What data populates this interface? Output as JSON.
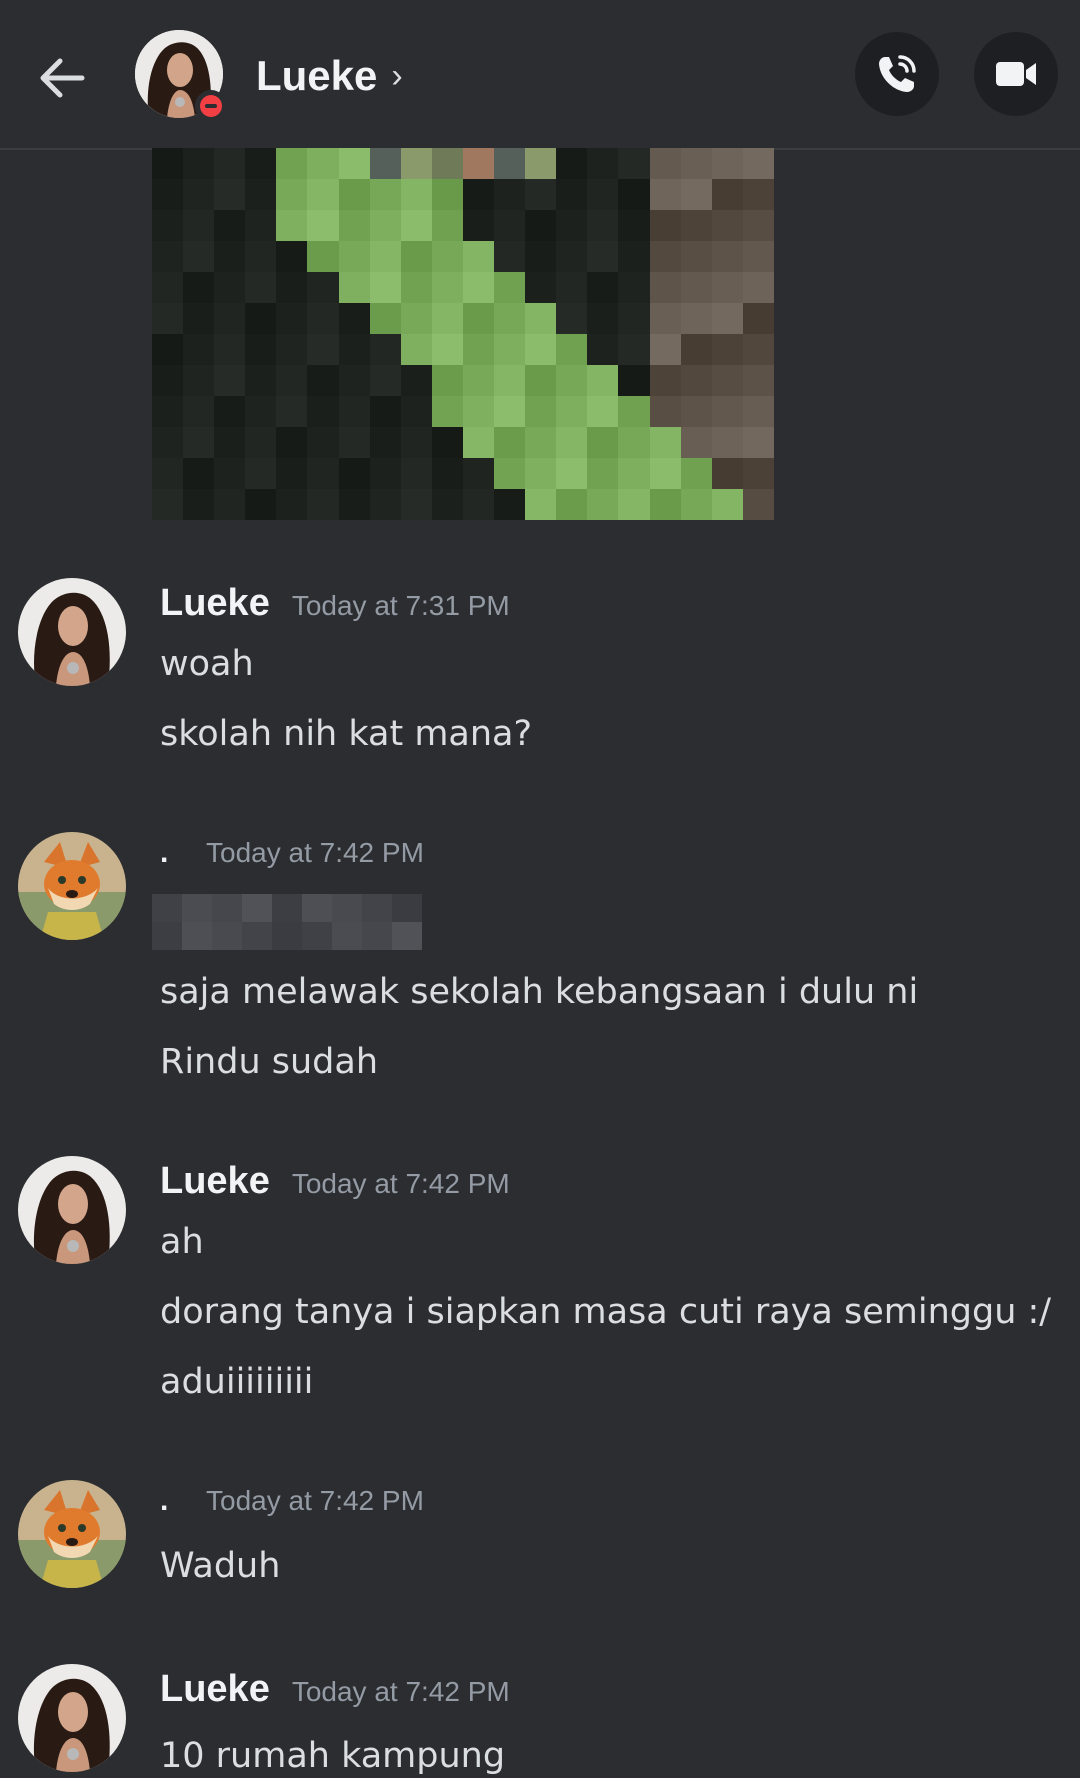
{
  "header": {
    "title": "Lueke",
    "chevron": "›",
    "status": "do-not-disturb",
    "icons": {
      "back": "arrow-left-icon",
      "call": "phone-call-icon",
      "video": "video-camera-icon"
    }
  },
  "colors": {
    "background": "#2b2d31",
    "text": "#dbdee1",
    "muted": "#949ba4",
    "dnd": "#f23f43"
  },
  "messages": [
    {
      "author": "Lueke",
      "timestamp": "Today at 7:31 PM",
      "lines": [
        "woah",
        "skolah nih kat mana?"
      ]
    },
    {
      "author": ".",
      "timestamp": "Today at 7:42 PM",
      "lines": [
        "saja melawak sekolah kebangsaan i dulu ni",
        "Rindu sudah"
      ]
    },
    {
      "author": "Lueke",
      "timestamp": "Today at 7:42 PM",
      "lines": [
        "ah",
        "dorang tanya i siapkan masa cuti raya seminggu :/",
        "aduiiiiiiiii"
      ]
    },
    {
      "author": ".",
      "timestamp": "Today at 7:42 PM",
      "lines": [
        "Waduh"
      ]
    },
    {
      "author": "Lueke",
      "timestamp": "Today at 7:42 PM",
      "lines": [
        "10 rumah kampung"
      ]
    }
  ]
}
